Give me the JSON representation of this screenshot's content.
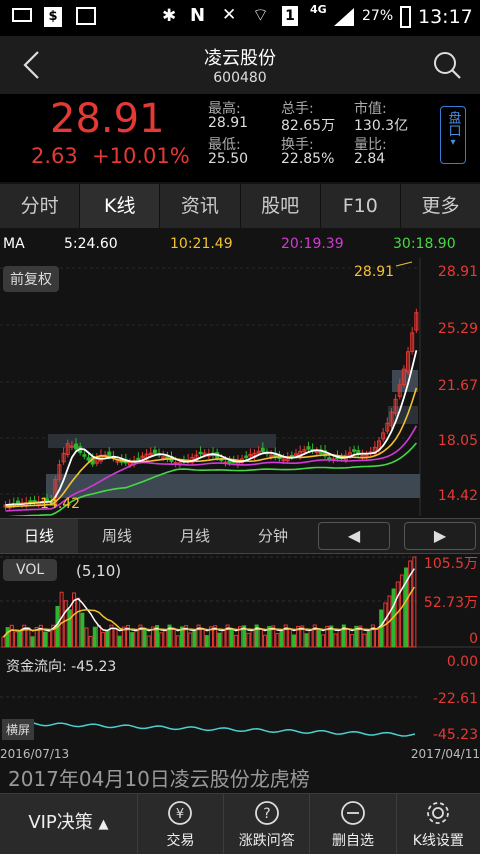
{
  "status": {
    "network": "4G",
    "battery": "27%",
    "time": "13:17"
  },
  "header": {
    "name": "凌云股份",
    "code": "600480"
  },
  "quote": {
    "price": "28.91",
    "change": "2.63",
    "change_pct": "+10.01%",
    "fields": [
      {
        "label": "最高:",
        "value": "28.91"
      },
      {
        "label": "总手:",
        "value": "82.65万"
      },
      {
        "label": "市值:",
        "value": "130.3亿"
      },
      {
        "label": "最低:",
        "value": "25.50"
      },
      {
        "label": "换手:",
        "value": "22.85%"
      },
      {
        "label": "量比:",
        "value": "2.84"
      }
    ],
    "pan_label": "盘口"
  },
  "tabs": [
    "分时",
    "K线",
    "资讯",
    "股吧",
    "F10",
    "更多"
  ],
  "ma": {
    "label": "MA",
    "ma5": "5:24.60",
    "ma10": "10:21.49",
    "ma20": "20:19.39",
    "ma30": "30:18.90"
  },
  "kline": {
    "fuquan": "前复权",
    "yticks": [
      "28.91",
      "25.29",
      "21.67",
      "18.05",
      "14.42"
    ],
    "high_label": "28.91",
    "low_label": "14.42"
  },
  "period_tabs": [
    "日线",
    "周线",
    "月线",
    "分钟"
  ],
  "volume": {
    "label": "VOL",
    "params": "(5,10)",
    "yticks": [
      "105.5万",
      "52.73万",
      "0"
    ]
  },
  "flow": {
    "label": "资金流向: -45.23",
    "yticks": [
      "0.00",
      "-22.61",
      "-45.23"
    ],
    "landscape": "横屏"
  },
  "dates": {
    "start": "2016/07/13",
    "end": "2017/04/11"
  },
  "news": "2017年04月10日凌云股份龙虎榜",
  "bottom": {
    "vip": "VIP决策",
    "items": [
      "交易",
      "涨跌问答",
      "删自选",
      "K线设置"
    ]
  },
  "colors": {
    "up": "#e53935",
    "down": "#2fb52f",
    "ma5": "#ffffff",
    "ma10": "#f2c230",
    "ma20": "#d23ad6",
    "ma30": "#46d846"
  }
}
